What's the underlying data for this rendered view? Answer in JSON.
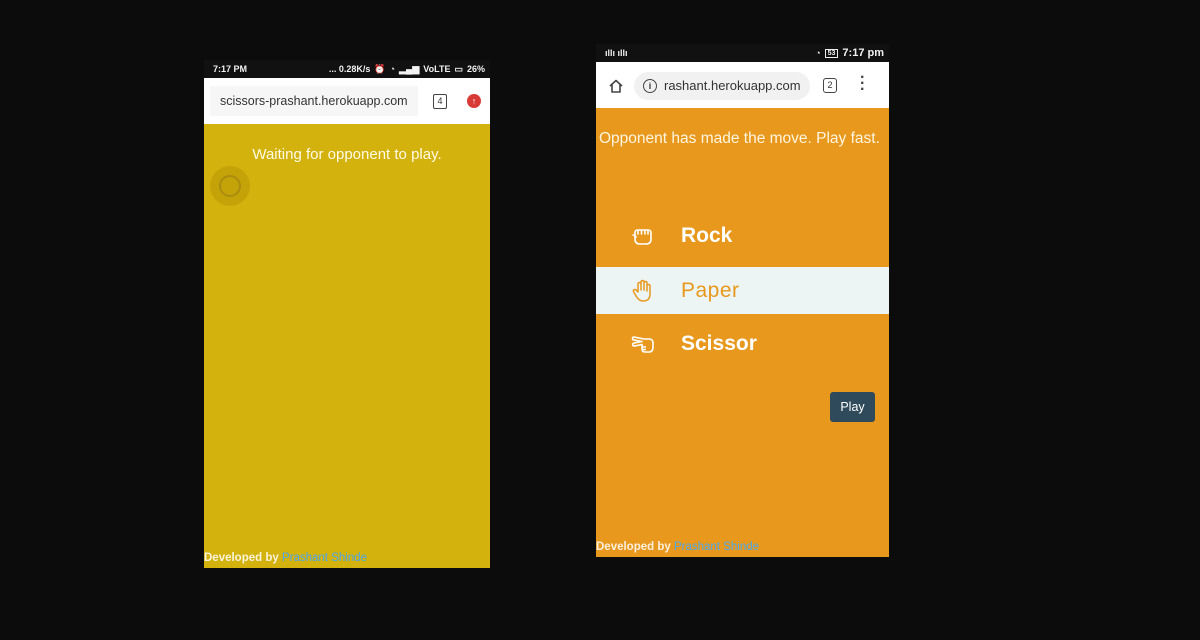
{
  "left_phone": {
    "status": {
      "time": "7:17 PM",
      "speed": "... 0.28K/s",
      "network": "VoLTE",
      "battery": "26%"
    },
    "browser": {
      "url": "scissors-prashant.herokuapp.com",
      "tab_count": "4"
    },
    "message": "Waiting for opponent to play.",
    "footer": {
      "prefix": "Developed by ",
      "author": "Prashant Shinde"
    }
  },
  "right_phone": {
    "status": {
      "time": "7:17 pm",
      "battery": "53"
    },
    "browser": {
      "url": "rashant.herokuapp.com",
      "tab_count": "2"
    },
    "message": "Opponent has made the move. Play fast.",
    "choices": [
      {
        "label": "Rock",
        "icon": "hand-rock-icon",
        "selected": false
      },
      {
        "label": "Paper",
        "icon": "hand-paper-icon",
        "selected": true
      },
      {
        "label": "Scissor",
        "icon": "hand-scissors-icon",
        "selected": false
      }
    ],
    "play_button": "Play",
    "footer": {
      "prefix": "Developed by ",
      "author": "Prashant Shinde"
    }
  },
  "colors": {
    "left_background": "#d3b20d",
    "right_background": "#e8991d",
    "selected_row": "#ecf4f4",
    "play_button": "#2f4a5b",
    "author_link": "#4ea7e8"
  }
}
